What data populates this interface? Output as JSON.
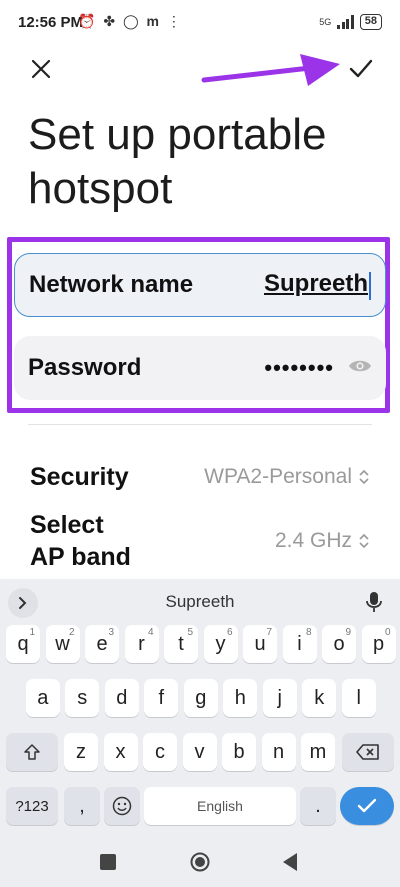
{
  "status_bar": {
    "time": "12:56 PM",
    "left_icons": [
      "alarm-icon",
      "fan-icon",
      "whatsapp-icon",
      "m-icon",
      "dots-icon"
    ],
    "network": "5G",
    "battery": "58"
  },
  "header": {
    "close_icon": "close-icon",
    "save_icon": "check-icon"
  },
  "title": "Set up portable hotspot",
  "form": {
    "network_name_label": "Network name",
    "network_name_value": "Supreeth",
    "password_label": "Password",
    "password_value": "••••••••",
    "password_toggle_icon": "eye-icon",
    "security_label": "Security",
    "security_value": "WPA2-Personal",
    "ap_band_label_line1": "Select",
    "ap_band_label_line2": "AP band",
    "ap_band_value": "2.4 GHz"
  },
  "annotation": {
    "highlight_color": "#9b34e8",
    "arrow_color": "#9b34e8"
  },
  "keyboard": {
    "suggestion": "Supreeth",
    "row1": [
      {
        "k": "q",
        "n": "1"
      },
      {
        "k": "w",
        "n": "2"
      },
      {
        "k": "e",
        "n": "3"
      },
      {
        "k": "r",
        "n": "4"
      },
      {
        "k": "t",
        "n": "5"
      },
      {
        "k": "y",
        "n": "6"
      },
      {
        "k": "u",
        "n": "7"
      },
      {
        "k": "i",
        "n": "8"
      },
      {
        "k": "o",
        "n": "9"
      },
      {
        "k": "p",
        "n": "0"
      }
    ],
    "row2": [
      "a",
      "s",
      "d",
      "f",
      "g",
      "h",
      "j",
      "k",
      "l"
    ],
    "row3": [
      "z",
      "x",
      "c",
      "v",
      "b",
      "n",
      "m"
    ],
    "symbols_key": "?123",
    "comma_key": ",",
    "space_label": "English",
    "period_key": ".",
    "shift_icon": "shift-icon",
    "backspace_icon": "backspace-icon",
    "emoji_icon": "emoji-icon",
    "enter_icon": "check-icon",
    "mic_icon": "mic-icon",
    "expand_icon": "chevron-right-icon"
  },
  "nav": {
    "recents_icon": "square-icon",
    "home_icon": "circle-icon",
    "back_icon": "triangle-icon"
  }
}
